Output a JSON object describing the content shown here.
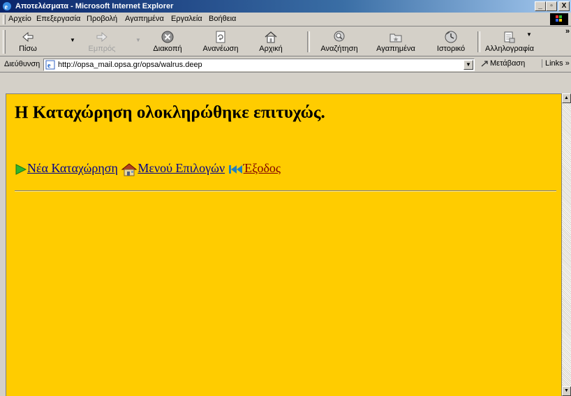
{
  "window": {
    "title": "Αποτελέσματα - Microsoft Internet Explorer",
    "minimize_glyph": "_",
    "maximize_glyph": "▫",
    "close_glyph": "X"
  },
  "menu": {
    "items": [
      "Αρχείο",
      "Επεξεργασία",
      "Προβολή",
      "Αγαπημένα",
      "Εργαλεία",
      "Βοήθεια"
    ]
  },
  "toolbar": {
    "back": "Πίσω",
    "forward": "Εμπρός",
    "stop": "Διακοπή",
    "refresh": "Ανανέωση",
    "home": "Αρχική",
    "search": "Αναζήτηση",
    "favorites": "Αγαπημένα",
    "history": "Ιστορικό",
    "mail": "Αλληλογραφία",
    "more_glyph": "»"
  },
  "address": {
    "label": "Διεύθυνση",
    "url": "http://opsa_mail.opsa.gr/opsa/walrus.deep",
    "go": "Μετάβαση",
    "links": "Links"
  },
  "page": {
    "heading": "Η Καταχώρηση ολοκληρώθηκε επιτυχώς.",
    "nav": {
      "new_entry": "Νέα Καταχώρηση",
      "options_menu": "Μενού Επιλογών",
      "exit": "Έξοδος"
    }
  },
  "colors": {
    "page_background": "#ffcc00",
    "link": "#00008b",
    "visited_link": "#800000"
  }
}
